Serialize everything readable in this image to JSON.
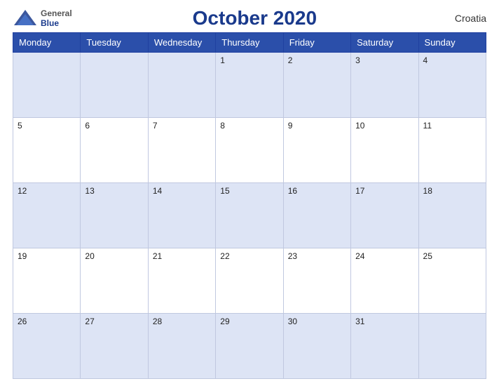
{
  "header": {
    "logo_general": "General",
    "logo_blue": "Blue",
    "title": "October 2020",
    "country": "Croatia"
  },
  "weekdays": [
    "Monday",
    "Tuesday",
    "Wednesday",
    "Thursday",
    "Friday",
    "Saturday",
    "Sunday"
  ],
  "weeks": [
    [
      {
        "day": "",
        "empty": true
      },
      {
        "day": "",
        "empty": true
      },
      {
        "day": "",
        "empty": true
      },
      {
        "day": "1",
        "empty": false
      },
      {
        "day": "2",
        "empty": false
      },
      {
        "day": "3",
        "empty": false
      },
      {
        "day": "4",
        "empty": false
      }
    ],
    [
      {
        "day": "5",
        "empty": false
      },
      {
        "day": "6",
        "empty": false
      },
      {
        "day": "7",
        "empty": false
      },
      {
        "day": "8",
        "empty": false
      },
      {
        "day": "9",
        "empty": false
      },
      {
        "day": "10",
        "empty": false
      },
      {
        "day": "11",
        "empty": false
      }
    ],
    [
      {
        "day": "12",
        "empty": false
      },
      {
        "day": "13",
        "empty": false
      },
      {
        "day": "14",
        "empty": false
      },
      {
        "day": "15",
        "empty": false
      },
      {
        "day": "16",
        "empty": false
      },
      {
        "day": "17",
        "empty": false
      },
      {
        "day": "18",
        "empty": false
      }
    ],
    [
      {
        "day": "19",
        "empty": false
      },
      {
        "day": "20",
        "empty": false
      },
      {
        "day": "21",
        "empty": false
      },
      {
        "day": "22",
        "empty": false
      },
      {
        "day": "23",
        "empty": false
      },
      {
        "day": "24",
        "empty": false
      },
      {
        "day": "25",
        "empty": false
      }
    ],
    [
      {
        "day": "26",
        "empty": false
      },
      {
        "day": "27",
        "empty": false
      },
      {
        "day": "28",
        "empty": false
      },
      {
        "day": "29",
        "empty": false
      },
      {
        "day": "30",
        "empty": false
      },
      {
        "day": "31",
        "empty": false
      },
      {
        "day": "",
        "empty": true
      }
    ]
  ]
}
